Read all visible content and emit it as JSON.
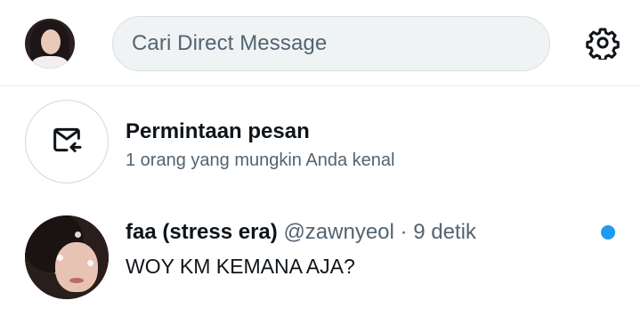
{
  "header": {
    "search_placeholder": "Cari Direct Message",
    "settings_icon": "gear-icon"
  },
  "message_requests": {
    "icon": "envelope-arrow-icon",
    "title": "Permintaan pesan",
    "subtitle": "1 orang yang mungkin Anda kenal"
  },
  "conversations": [
    {
      "name": "faa (stress era)",
      "handle": "@zawnyeol",
      "separator": "·",
      "time": "9 detik",
      "message": "WOY KM KEMANA AJA?",
      "unread": true
    }
  ],
  "colors": {
    "accent": "#1d9bf0",
    "secondary_text": "#536471",
    "primary_text": "#0f1419"
  }
}
